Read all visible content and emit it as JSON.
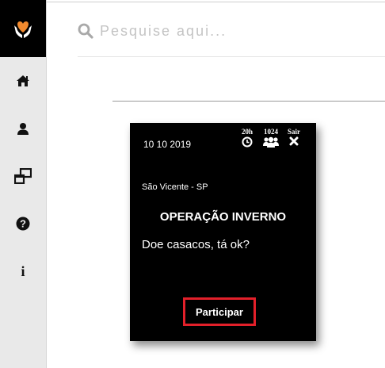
{
  "search": {
    "placeholder": "Pesquise aqui..."
  },
  "sidebar": {
    "items": [
      {
        "icon": "home-icon"
      },
      {
        "icon": "user-icon"
      },
      {
        "icon": "windows-icon"
      },
      {
        "icon": "help-icon"
      },
      {
        "icon": "info-icon"
      }
    ]
  },
  "card": {
    "date": "10 10 2019",
    "time_label": "20h",
    "participants_label": "1024",
    "exit_label": "Sair",
    "location": "São Vicente - SP",
    "title": "OPERAÇÃO INVERNO",
    "description": "Doe casacos, tá ok?",
    "join_label": "Participar"
  },
  "colors": {
    "logo_heart": "#f28a2e",
    "button_border": "#e3202a",
    "sidebar_bg": "#e9e9e9",
    "card_bg": "#000000"
  }
}
